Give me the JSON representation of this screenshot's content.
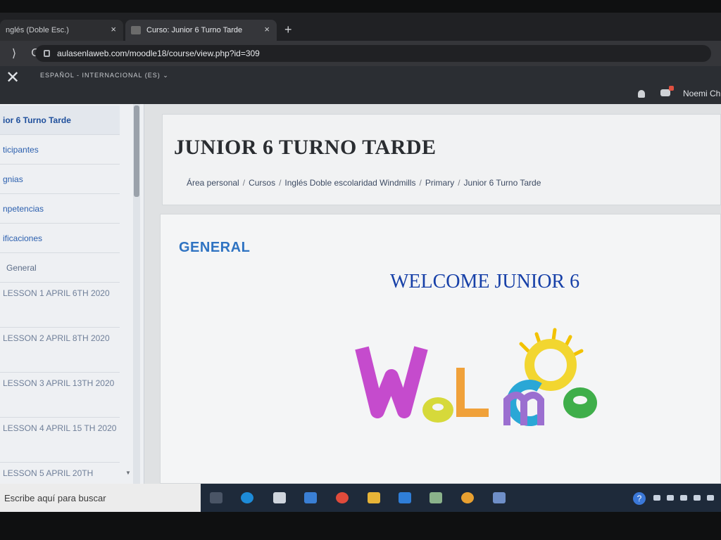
{
  "browser": {
    "tabs": [
      {
        "title": "nglés (Doble Esc.)",
        "active": false,
        "close": "×"
      },
      {
        "title": "Curso: Junior 6 Turno Tarde",
        "active": true,
        "close": "×"
      }
    ],
    "new_tab": "+",
    "back": "⟩",
    "reload": "C",
    "url": "aulasenlaweb.com/moodle18/course/view.php?id=309"
  },
  "navbar": {
    "close_glyph": "✕",
    "language": "ESPAÑOL - INTERNACIONAL (ES) ⌄",
    "user": "Noemi Ch"
  },
  "drawer": {
    "items": [
      {
        "label": "ior 6 Turno Tarde",
        "active": true
      },
      {
        "label": "ticipantes"
      },
      {
        "label": "gnias"
      },
      {
        "label": "npetencias"
      },
      {
        "label": "ificaciones"
      },
      {
        "label": "General"
      },
      {
        "label": "LESSON 1 APRIL 6TH 2020"
      },
      {
        "label": "LESSON 2 APRIL 8TH 2020"
      },
      {
        "label": "LESSON 3 APRIL 13TH 2020"
      },
      {
        "label": "LESSON 4 APRIL 15 TH 2020"
      },
      {
        "label": "LESSON 5 APRIL 20TH"
      }
    ]
  },
  "course": {
    "title": "JUNIOR 6 TURNO TARDE",
    "breadcrumb": [
      "Área personal",
      "Cursos",
      "Inglés Doble escolaridad Windmills",
      "Primary",
      "Junior 6 Turno Tarde"
    ],
    "breadcrumb_sep": "/"
  },
  "section": {
    "title": "GENERAL",
    "heading": "WELCOME JUNIOR 6",
    "image_text": "Welcome"
  },
  "taskbar": {
    "search_placeholder": "Escribe aquí para buscar",
    "help_glyph": "?"
  },
  "colors": {
    "moodle_link": "#2b5fae",
    "section_blue": "#2f73c2",
    "heading_blue": "#1740a8"
  }
}
